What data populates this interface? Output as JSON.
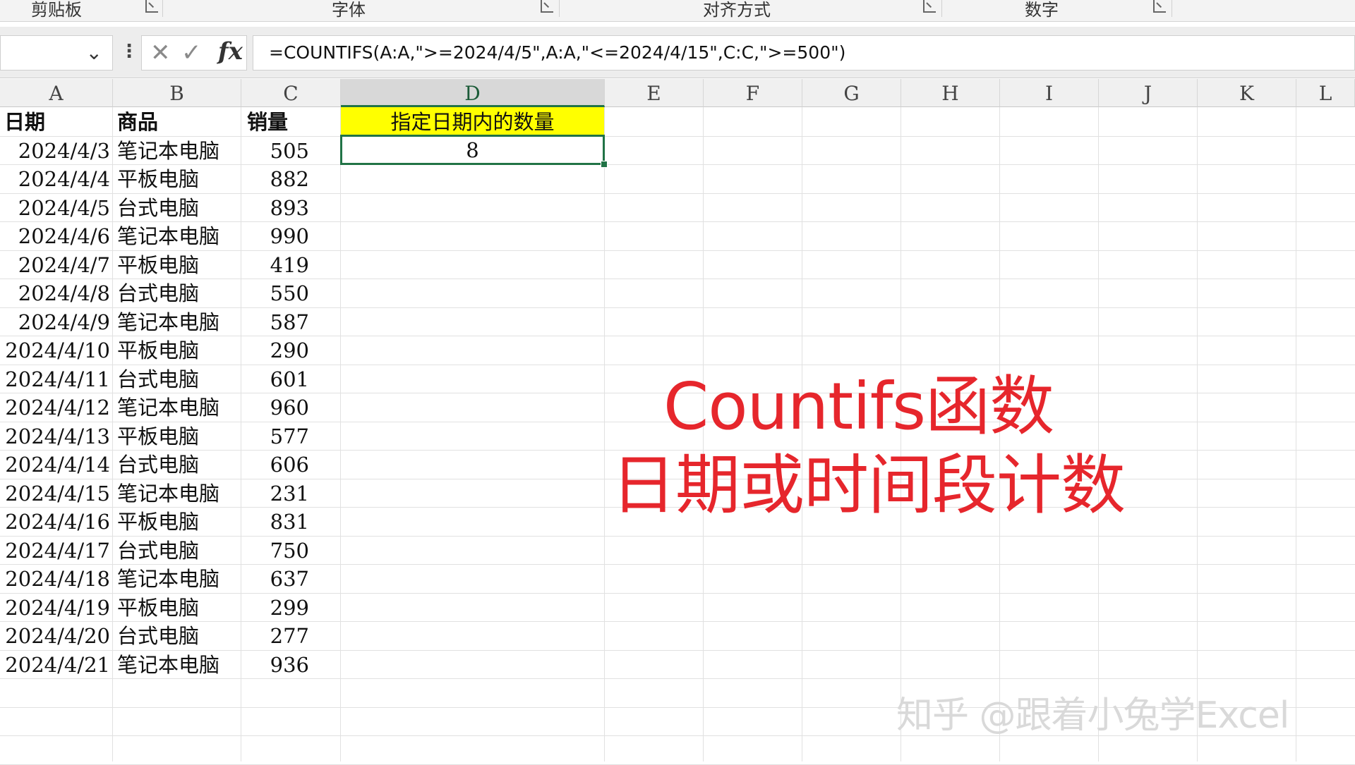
{
  "ribbon": {
    "groups": [
      {
        "label": "剪贴板"
      },
      {
        "label": "字体"
      },
      {
        "label": "对齐方式"
      },
      {
        "label": "数字"
      }
    ]
  },
  "formula_bar": {
    "name_box": "",
    "formula": "=COUNTIFS(A:A,\">=2024/4/5\",A:A,\"<=2024/4/15\",C:C,\">=500\")",
    "fx": "fx"
  },
  "columns": [
    "A",
    "B",
    "C",
    "D",
    "E",
    "F",
    "G",
    "H",
    "I",
    "J",
    "K",
    "L"
  ],
  "active_column": "D",
  "table": {
    "headers": {
      "date": "日期",
      "product": "商品",
      "sales": "销量",
      "d_header": "指定日期内的数量"
    },
    "result": "8",
    "rows": [
      {
        "date": "2024/4/3",
        "product": "笔记本电脑",
        "sales": "505"
      },
      {
        "date": "2024/4/4",
        "product": "平板电脑",
        "sales": "882"
      },
      {
        "date": "2024/4/5",
        "product": "台式电脑",
        "sales": "893"
      },
      {
        "date": "2024/4/6",
        "product": "笔记本电脑",
        "sales": "990"
      },
      {
        "date": "2024/4/7",
        "product": "平板电脑",
        "sales": "419"
      },
      {
        "date": "2024/4/8",
        "product": "台式电脑",
        "sales": "550"
      },
      {
        "date": "2024/4/9",
        "product": "笔记本电脑",
        "sales": "587"
      },
      {
        "date": "2024/4/10",
        "product": "平板电脑",
        "sales": "290"
      },
      {
        "date": "2024/4/11",
        "product": "台式电脑",
        "sales": "601"
      },
      {
        "date": "2024/4/12",
        "product": "笔记本电脑",
        "sales": "960"
      },
      {
        "date": "2024/4/13",
        "product": "平板电脑",
        "sales": "577"
      },
      {
        "date": "2024/4/14",
        "product": "台式电脑",
        "sales": "606"
      },
      {
        "date": "2024/4/15",
        "product": "笔记本电脑",
        "sales": "231"
      },
      {
        "date": "2024/4/16",
        "product": "平板电脑",
        "sales": "831"
      },
      {
        "date": "2024/4/17",
        "product": "台式电脑",
        "sales": "750"
      },
      {
        "date": "2024/4/18",
        "product": "笔记本电脑",
        "sales": "637"
      },
      {
        "date": "2024/4/19",
        "product": "平板电脑",
        "sales": "299"
      },
      {
        "date": "2024/4/20",
        "product": "台式电脑",
        "sales": "277"
      },
      {
        "date": "2024/4/21",
        "product": "笔记本电脑",
        "sales": "936"
      }
    ]
  },
  "overlay": {
    "line1": "Countifs函数",
    "line2": "日期或时间段计数",
    "watermark": "知乎 @跟着小兔学Excel"
  },
  "colors": {
    "accent_green": "#217346",
    "caption_red": "#e6262c",
    "header_yellow": "#ffff00"
  }
}
